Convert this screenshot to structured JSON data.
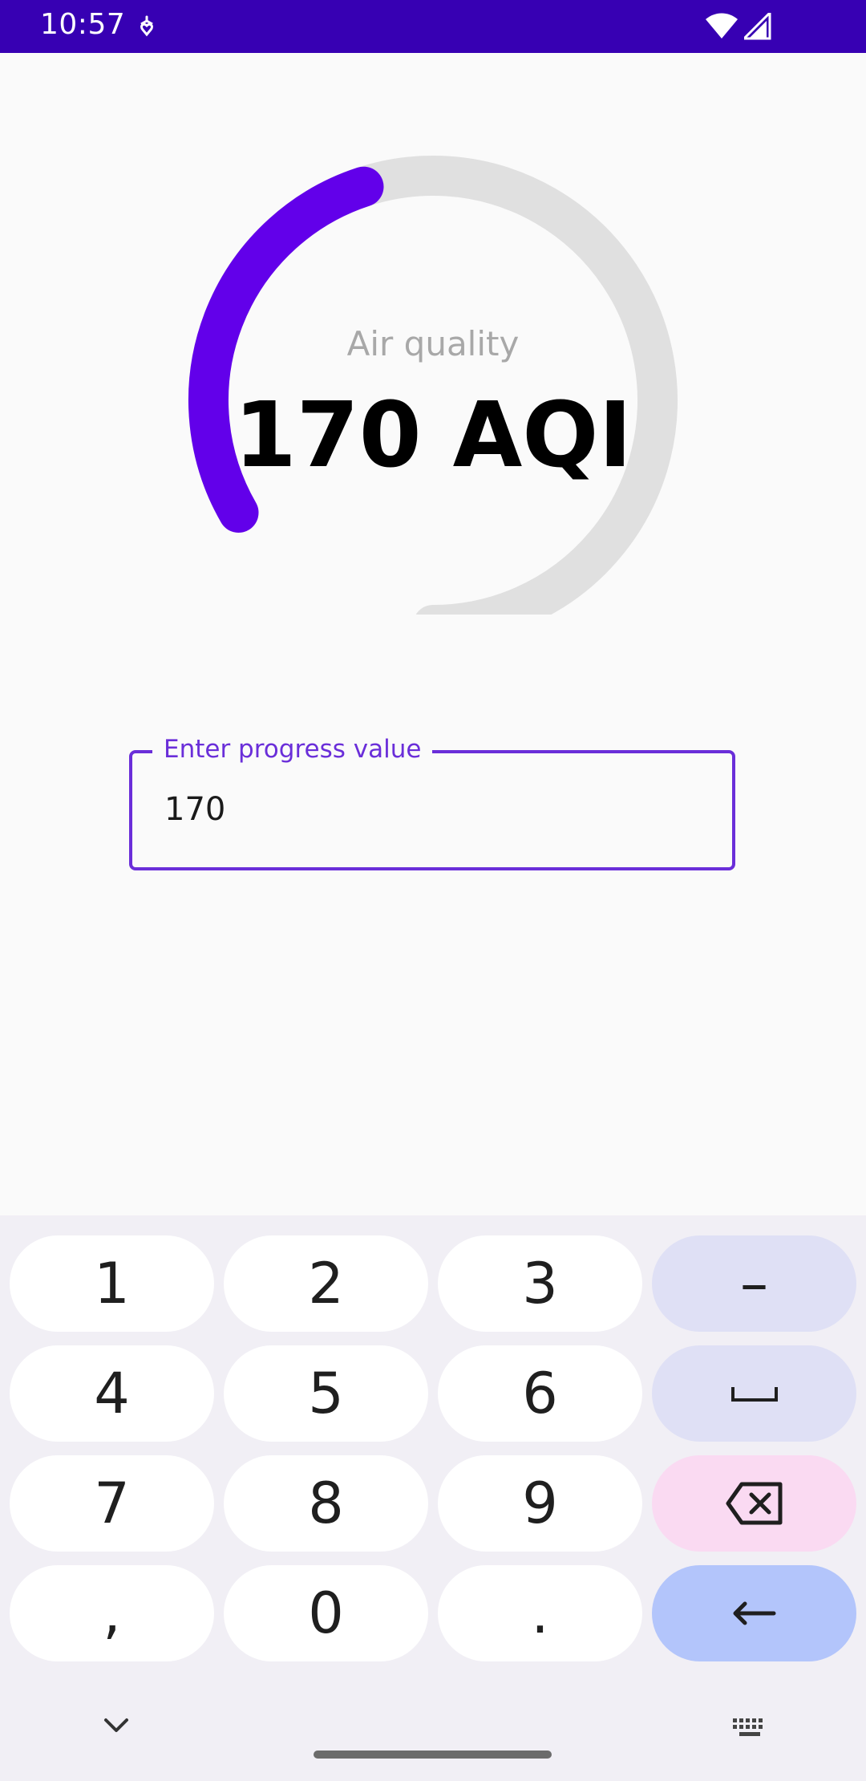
{
  "status_bar": {
    "time": "10:57",
    "icons": [
      "notification-icon",
      "wifi-icon",
      "cellular-signal-icon"
    ]
  },
  "gauge": {
    "label": "Air quality",
    "value_text": "170 AQI",
    "progress_value": 170,
    "track_color": "#e0e0e0",
    "progress_color": "#6200ea"
  },
  "input": {
    "label": "Enter progress value",
    "value": "170",
    "accent_color": "#6a2ed9"
  },
  "keyboard": {
    "rows": [
      [
        "1",
        "2",
        "3",
        "–"
      ],
      [
        "4",
        "5",
        "6",
        "space"
      ],
      [
        "7",
        "8",
        "9",
        "backspace"
      ],
      [
        ",",
        "0",
        ".",
        "enter"
      ]
    ],
    "bottom_left_icon": "chevron-down-icon",
    "bottom_right_icon": "keyboard-icon"
  }
}
